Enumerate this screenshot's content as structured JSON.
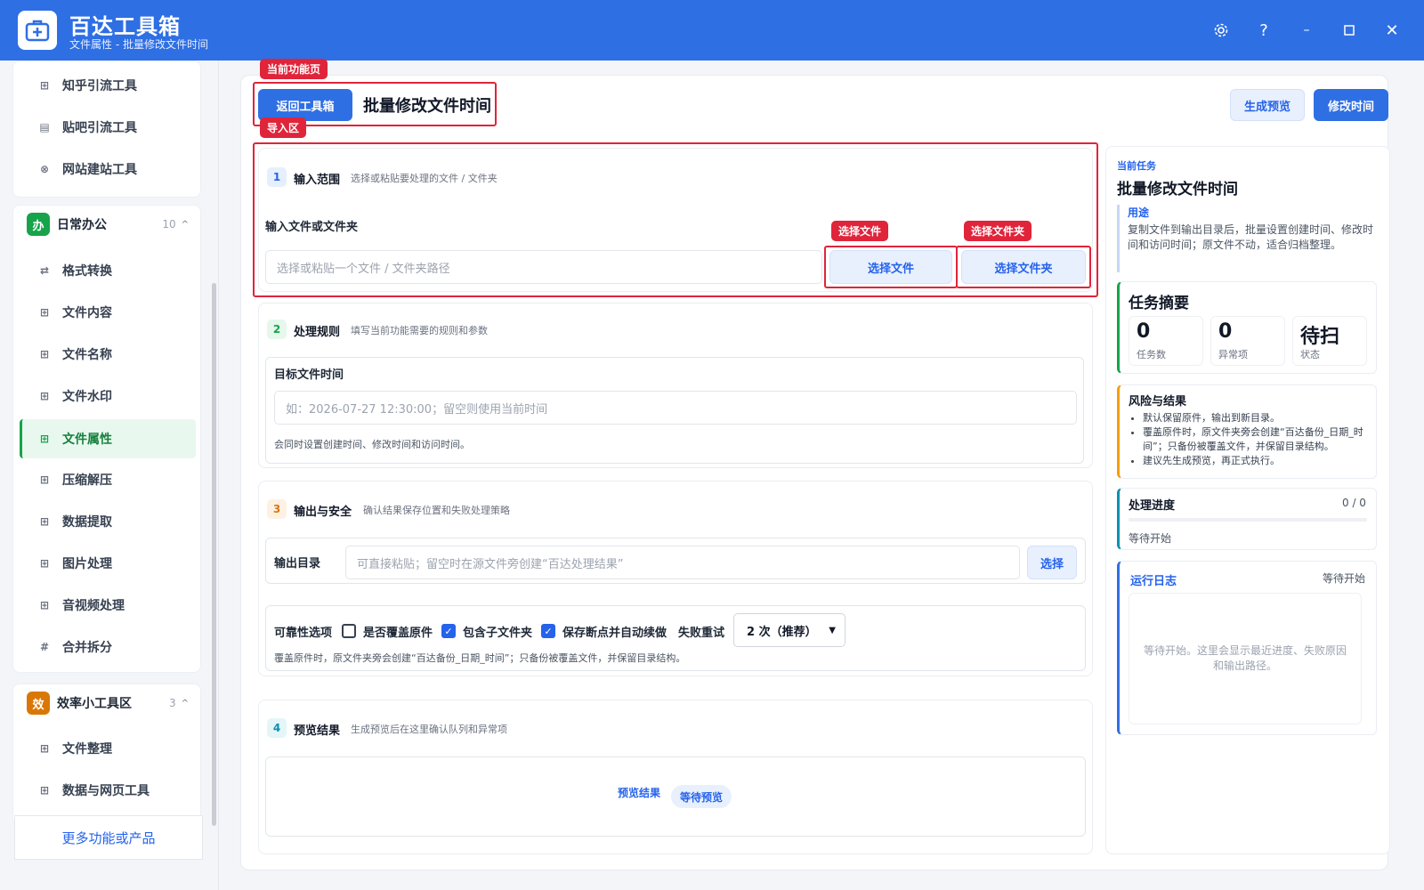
{
  "app": {
    "title": "百达工具箱",
    "subtitle": "文件属性 - 批量修改文件时间"
  },
  "window_controls": [
    "gear-icon",
    "help-icon",
    "minimize-icon",
    "maximize-icon",
    "close-icon"
  ],
  "sidebar": {
    "top_items": [
      {
        "label": "知乎引流工具",
        "icon": "⊞"
      },
      {
        "label": "贴吧引流工具",
        "icon": "▤"
      },
      {
        "label": "网站建站工具",
        "icon": "⊗"
      }
    ],
    "group_daily": {
      "badge": "办",
      "title": "日常办公",
      "count": "10",
      "caret": "^",
      "items": [
        {
          "label": "格式转换",
          "icon": "⇄"
        },
        {
          "label": "文件内容",
          "icon": "⊞"
        },
        {
          "label": "文件名称",
          "icon": "⊞"
        },
        {
          "label": "文件水印",
          "icon": "⊞"
        },
        {
          "label": "文件属性",
          "icon": "⊞",
          "active": true
        },
        {
          "label": "压缩解压",
          "icon": "⊞"
        },
        {
          "label": "数据提取",
          "icon": "⊞"
        },
        {
          "label": "图片处理",
          "icon": "⊞"
        },
        {
          "label": "音视频处理",
          "icon": "⊞"
        },
        {
          "label": "合并拆分",
          "icon": "#"
        }
      ]
    },
    "group_efficiency": {
      "badge": "效",
      "title": "效率小工具区",
      "count": "3",
      "caret": "^",
      "items": [
        {
          "label": "文件整理",
          "icon": "⊞"
        },
        {
          "label": "数据与网页工具",
          "icon": "⊞"
        }
      ]
    },
    "more_label": "更多功能或产品"
  },
  "header": {
    "tag_current": "当前功能页",
    "back_label": "返回工具箱",
    "page_title": "批量修改文件时间",
    "preview_label": "生成预览",
    "modify_label": "修改时间"
  },
  "import": {
    "tag": "导入区",
    "num": "1",
    "title": "输入范围",
    "desc": "选择或粘贴要处理的文件 / 文件夹",
    "field_label": "输入文件或文件夹",
    "placeholder": "选择或粘贴一个文件 / 文件夹路径",
    "tag_file": "选择文件",
    "tag_folder": "选择文件夹",
    "btn_file": "选择文件",
    "btn_folder": "选择文件夹"
  },
  "rules": {
    "num": "2",
    "title": "处理规则",
    "desc": "填写当前功能需要的规则和参数",
    "field_label": "目标文件时间",
    "placeholder": "如：2026-07-27 12:30:00；留空则使用当前时间",
    "hint": "会同时设置创建时间、修改时间和访问时间。"
  },
  "output": {
    "num": "3",
    "title": "输出与安全",
    "desc": "确认结果保存位置和失败处理策略",
    "dir_label": "输出目录",
    "dir_placeholder": "可直接粘贴；留空时在源文件旁创建“百达处理结果”",
    "choose_label": "选择",
    "options_label": "可靠性选项",
    "opt_overwrite": "是否覆盖原件",
    "opt_overwrite_checked": false,
    "opt_subfolders": "包含子文件夹",
    "opt_subfolders_checked": true,
    "opt_resume": "保存断点并自动续做",
    "opt_resume_checked": true,
    "retry_label": "失败重试",
    "retry_value": "2 次（推荐）",
    "hint": "覆盖原件时，原文件夹旁会创建“百达备份_日期_时间”；只备份被覆盖文件，并保留目录结构。"
  },
  "preview": {
    "num": "4",
    "title": "预览结果",
    "desc": "生成预览后在这里确认队列和异常项",
    "result_label": "预览结果",
    "status_badge": "等待预览"
  },
  "right": {
    "current_task_label": "当前任务",
    "task_title": "批量修改文件时间",
    "usage_label": "用途",
    "usage_text": "复制文件到输出目录后，批量设置创建时间、修改时间和访问时间；原文件不动，适合归档整理。",
    "summary_title": "任务摘要",
    "stats": [
      {
        "value": "0",
        "label": "任务数"
      },
      {
        "value": "0",
        "label": "异常项"
      },
      {
        "value": "待扫",
        "label": "状态"
      }
    ],
    "risk_title": "风险与结果",
    "risk_items": [
      "默认保留原件，输出到新目录。",
      "覆盖原件时，原文件夹旁会创建“百达备份_日期_时间”；只备份被覆盖文件，并保留目录结构。",
      "建议先生成预览，再正式执行。"
    ],
    "progress_title": "处理进度",
    "progress_count": "0 / 0",
    "progress_value": 0,
    "progress_status": "等待开始",
    "log_title": "运行日志",
    "log_status": "等待开始",
    "log_placeholder": "等待开始。这里会显示最近进度、失败原因和输出路径。"
  },
  "colors": {
    "brand": "#2f6fe4",
    "annotation_red": "#e0243a",
    "active_green": "#16a34a"
  }
}
